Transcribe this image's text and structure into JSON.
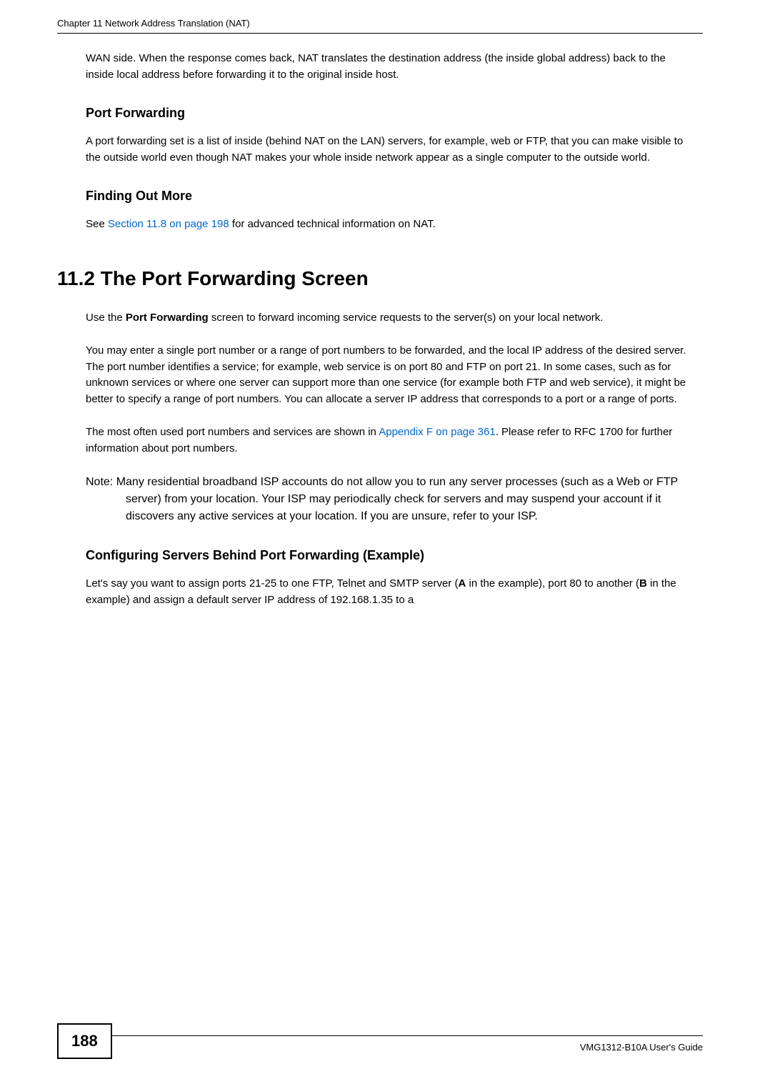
{
  "header": {
    "chapter": "Chapter 11 Network Address Translation (NAT)"
  },
  "intro_paragraph": "WAN side. When the response comes back, NAT translates the destination address (the inside global address) back to the inside local address before forwarding it to the original inside host.",
  "port_forwarding": {
    "heading": "Port Forwarding",
    "body": "A port forwarding set is a list of inside (behind NAT on the LAN) servers, for example, web or FTP, that you can make visible to the outside world even though NAT makes your whole inside network appear as a single computer to the outside world."
  },
  "finding_out_more": {
    "heading": "Finding Out More",
    "prefix": "See ",
    "link_text": "Section 11.8 on page 198",
    "suffix": " for advanced technical information on NAT."
  },
  "section_11_2": {
    "heading": "11.2  The Port Forwarding Screen",
    "p1_prefix": "Use the ",
    "p1_bold": "Port Forwarding",
    "p1_suffix": " screen to forward incoming service requests to the server(s) on your local network.",
    "p2": "You may enter a single port number or a range of port numbers to be forwarded, and the local IP address of the desired server. The port number identifies a service; for example, web service is on port 80 and FTP on port 21. In some cases, such as for unknown services or where one server can support more than one service (for example both FTP and web service), it might be better to specify a range of port numbers. You can allocate a server IP address that corresponds to a port or a range of ports.",
    "p3_prefix": "The most often used port numbers and services are shown in ",
    "p3_link": "Appendix F on page 361",
    "p3_suffix": ". Please refer to RFC 1700 for further information about port numbers.",
    "note": "Note: Many residential broadband ISP accounts do not allow you to run any server processes (such as a Web or FTP server) from your location. Your ISP may periodically check for servers and may suspend your account if it discovers any active services at your location. If you are unsure, refer to your ISP."
  },
  "configuring_servers": {
    "heading": "Configuring Servers Behind Port Forwarding (Example)",
    "p1_part1": "Let's say you want to assign ports 21-25 to one FTP, Telnet and SMTP server (",
    "p1_bold1": "A",
    "p1_part2": " in the example), port 80 to another (",
    "p1_bold2": "B",
    "p1_part3": " in the example) and assign a default server IP address of 192.168.1.35 to a"
  },
  "footer": {
    "page_number": "188",
    "guide_text": "VMG1312-B10A User's Guide"
  }
}
